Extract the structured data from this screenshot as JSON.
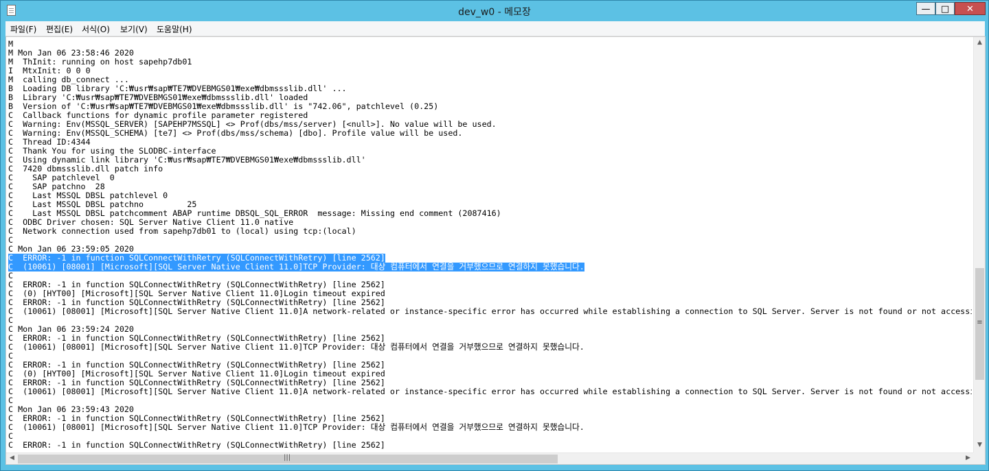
{
  "window": {
    "title": "dev_w0 - 메모장"
  },
  "menu": [
    "파일(F)",
    "편집(E)",
    "서식(O)",
    "보기(V)",
    "도움말(H)"
  ],
  "lines": [
    "M",
    "M Mon Jan 06 23:58:46 2020",
    "M  ThInit: running on host sapehp7db01",
    "I  MtxInit: 0 0 0",
    "M  calling db_connect ...",
    "B  Loading DB library 'C:₩usr₩sap₩TE7₩DVEBMGS01₩exe₩dbmssslib.dll' ...",
    "B  Library 'C:₩usr₩sap₩TE7₩DVEBMGS01₩exe₩dbmssslib.dll' loaded",
    "B  Version of 'C:₩usr₩sap₩TE7₩DVEBMGS01₩exe₩dbmssslib.dll' is \"742.06\", patchlevel (0.25)",
    "C  Callback functions for dynamic profile parameter registered",
    "C  Warning: Env(MSSQL_SERVER) [SAPEHP7MSSQL] <> Prof(dbs/mss/server) [<null>]. No value will be used.",
    "C  Warning: Env(MSSQL_SCHEMA) [te7] <> Prof(dbs/mss/schema) [dbo]. Profile value will be used.",
    "C  Thread ID:4344",
    "C  Thank You for using the SLODBC-interface",
    "C  Using dynamic link library 'C:₩usr₩sap₩TE7₩DVEBMGS01₩exe₩dbmssslib.dll'",
    "C  7420 dbmssslib.dll patch info",
    "C    SAP patchlevel  0",
    "C    SAP patchno  28",
    "C    Last MSSQL DBSL patchlevel 0",
    "C    Last MSSQL DBSL patchno         25",
    "C    Last MSSQL DBSL patchcomment ABAP runtime DBSQL_SQL_ERROR  message: Missing end comment (2087416)",
    "C  ODBC Driver chosen: SQL Server Native Client 11.0 native",
    "C  Network connection used from sapehp7db01 to (local) using tcp:(local)",
    "C",
    "C Mon Jan 06 23:59:05 2020",
    "C  ERROR: -1 in function SQLConnectWithRetry (SQLConnectWithRetry) [line 2562]",
    "C  (10061) [08001] [Microsoft][SQL Server Native Client 11.0]TCP Provider: 대상 컴퓨터에서 연결을 거부했으므로 연결하지 못했습니다.",
    "C",
    "C  ERROR: -1 in function SQLConnectWithRetry (SQLConnectWithRetry) [line 2562]",
    "C  (0) [HYT00] [Microsoft][SQL Server Native Client 11.0]Login timeout expired",
    "C  ERROR: -1 in function SQLConnectWithRetry (SQLConnectWithRetry) [line 2562]",
    "C  (10061) [08001] [Microsoft][SQL Server Native Client 11.0]A network-related or instance-specific error has occurred while establishing a connection to SQL Server. Server is not found or not accessi",
    "C",
    "C Mon Jan 06 23:59:24 2020",
    "C  ERROR: -1 in function SQLConnectWithRetry (SQLConnectWithRetry) [line 2562]",
    "C  (10061) [08001] [Microsoft][SQL Server Native Client 11.0]TCP Provider: 대상 컴퓨터에서 연결을 거부했으므로 연결하지 못했습니다.",
    "C",
    "C  ERROR: -1 in function SQLConnectWithRetry (SQLConnectWithRetry) [line 2562]",
    "C  (0) [HYT00] [Microsoft][SQL Server Native Client 11.0]Login timeout expired",
    "C  ERROR: -1 in function SQLConnectWithRetry (SQLConnectWithRetry) [line 2562]",
    "C  (10061) [08001] [Microsoft][SQL Server Native Client 11.0]A network-related or instance-specific error has occurred while establishing a connection to SQL Server. Server is not found or not accessi",
    "C",
    "C Mon Jan 06 23:59:43 2020",
    "C  ERROR: -1 in function SQLConnectWithRetry (SQLConnectWithRetry) [line 2562]",
    "C  (10061) [08001] [Microsoft][SQL Server Native Client 11.0]TCP Provider: 대상 컴퓨터에서 연결을 거부했으므로 연결하지 못했습니다.",
    "C",
    "C  ERROR: -1 in function SQLConnectWithRetry (SQLConnectWithRetry) [line 2562]"
  ],
  "selected_lines": [
    24,
    25
  ],
  "colors": {
    "titlebar": "#5cc1e4",
    "selection": "#3399ff",
    "close_button": "#c75050"
  },
  "icons": [
    "notepad-icon",
    "minimize-icon",
    "maximize-icon",
    "close-icon",
    "scroll-up-arrow-icon",
    "scroll-down-arrow-icon",
    "scroll-left-arrow-icon",
    "scroll-right-arrow-icon",
    "grip-icon"
  ],
  "scroll": {
    "vertical_position_fraction": 0.68,
    "vertical_visible_fraction": 0.29,
    "horizontal_position_fraction": 0.0,
    "horizontal_visible_fraction": 0.57
  }
}
